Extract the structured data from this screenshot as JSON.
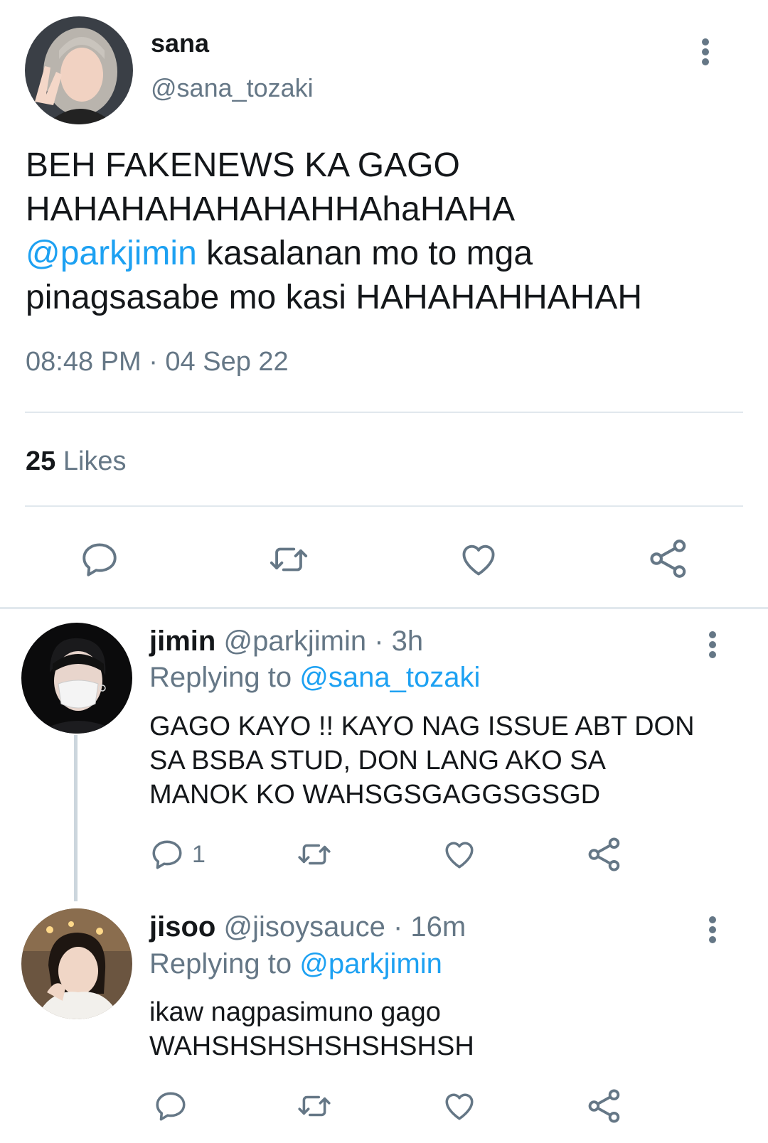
{
  "colors": {
    "link": "#1da1f2",
    "muted": "#657786",
    "text": "#14171a",
    "divider": "#e1e8ed",
    "thread_line": "#ccd6dd"
  },
  "main_tweet": {
    "avatar_icon": "sana-avatar",
    "display_name": "sana",
    "handle": "@sana_tozaki",
    "text_line1": "BEH FAKENEWS KA GAGO",
    "text_line2": "HAHAHAHAHAHAHHAhaHAHA",
    "mention": "@parkjimin",
    "text_line3_rest": " kasalanan mo to mga",
    "text_line4": "pinagsasabe mo kasi HAHAHAHHAHAH",
    "timestamp": "08:48 PM · 04 Sep 22",
    "likes_count": "25",
    "likes_label": "Likes",
    "actions": [
      "reply-icon",
      "retweet-icon",
      "like-icon",
      "share-icon"
    ]
  },
  "replies": [
    {
      "avatar_icon": "jimin-avatar",
      "display_name": "jimin",
      "meta": "@parkjimin · 3h",
      "replying_label": "Replying to",
      "replying_to": "@sana_tozaki",
      "text_line1": "GAGO KAYO !! KAYO NAG ISSUE ABT DON",
      "text_line2": "SA BSBA STUD, DON LANG AKO SA",
      "text_line3": "MANOK KO WAHSGSGAGGSGSGD",
      "reply_count": "1"
    },
    {
      "avatar_icon": "jisoo-avatar",
      "display_name": "jisoo",
      "meta": "@jisoysauce · 16m",
      "replying_label": "Replying to",
      "replying_to": "@parkjimin",
      "text_line1": "ikaw nagpasimuno gago",
      "text_line2": "WAHSHSHSHSHSHSHSH"
    }
  ]
}
